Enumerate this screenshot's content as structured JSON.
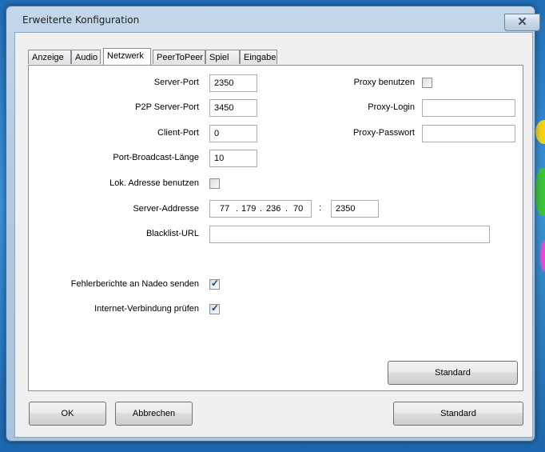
{
  "window": {
    "title": "Erweiterte Konfiguration",
    "close_symbol": "✕"
  },
  "tabs": [
    "Anzeige",
    "Audio",
    "Netzwerk",
    "PeerToPeer",
    "Spiel",
    "Eingabe"
  ],
  "active_tab": "Netzwerk",
  "network": {
    "server_port": {
      "label": "Server-Port",
      "value": "2350"
    },
    "p2p_server_port": {
      "label": "P2P Server-Port",
      "value": "3450"
    },
    "client_port": {
      "label": "Client-Port",
      "value": "0"
    },
    "port_broadcast_length": {
      "label": "Port-Broadcast-Länge",
      "value": "10"
    },
    "use_local_address": {
      "label": "Lok. Adresse benutzen",
      "checked": false
    },
    "server_address": {
      "label": "Server-Addresse",
      "ip": [
        "77",
        "179",
        "236",
        "70"
      ],
      "port_separator": ":",
      "port": "2350"
    },
    "blacklist_url": {
      "label": "Blacklist-URL",
      "value": ""
    },
    "send_error_reports": {
      "label": "Fehlerberichte an Nadeo senden",
      "checked": true
    },
    "check_internet": {
      "label": "Internet-Verbindung prüfen",
      "checked": true
    },
    "use_proxy": {
      "label": "Proxy benutzen",
      "checked": false
    },
    "proxy_login": {
      "label": "Proxy-Login",
      "value": ""
    },
    "proxy_password": {
      "label": "Proxy-Passwort",
      "value": ""
    }
  },
  "buttons": {
    "panel_default": "Standard",
    "ok": "OK",
    "cancel": "Abbrechen",
    "default": "Standard"
  },
  "checkmark": "✓"
}
